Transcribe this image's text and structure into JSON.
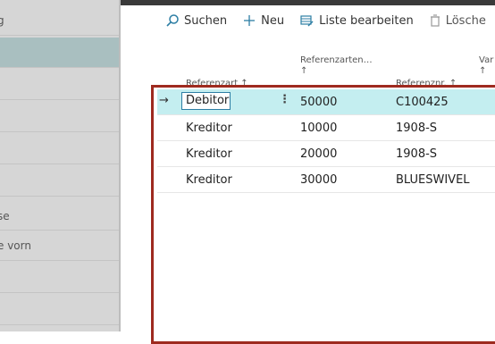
{
  "sidebar": {
    "items": [
      "g",
      "",
      "",
      "",
      "",
      "",
      "se",
      "e vorn",
      "",
      ""
    ]
  },
  "toolbar": {
    "search": "Suchen",
    "new": "Neu",
    "edit_list": "Liste bearbeiten",
    "delete": "Lösche"
  },
  "table": {
    "headers": {
      "ref_type": "Referenzart ↑",
      "ref_types": "Referenzarten…",
      "ref_types_arrow": "↑",
      "ref_no": "Referenznr. ↑",
      "var": "Var",
      "var_arrow": "↑"
    },
    "rows": [
      {
        "type": "Debitor",
        "types": "50000",
        "no": "C100425"
      },
      {
        "type": "Kreditor",
        "types": "10000",
        "no": "1908-S"
      },
      {
        "type": "Kreditor",
        "types": "20000",
        "no": "1908-S"
      },
      {
        "type": "Kreditor",
        "types": "30000",
        "no": "BLUESWIVEL"
      }
    ]
  },
  "colors": {
    "accent": "#2d7ea4",
    "selected_row": "#c4eef0",
    "frame": "#9e2a1f"
  }
}
